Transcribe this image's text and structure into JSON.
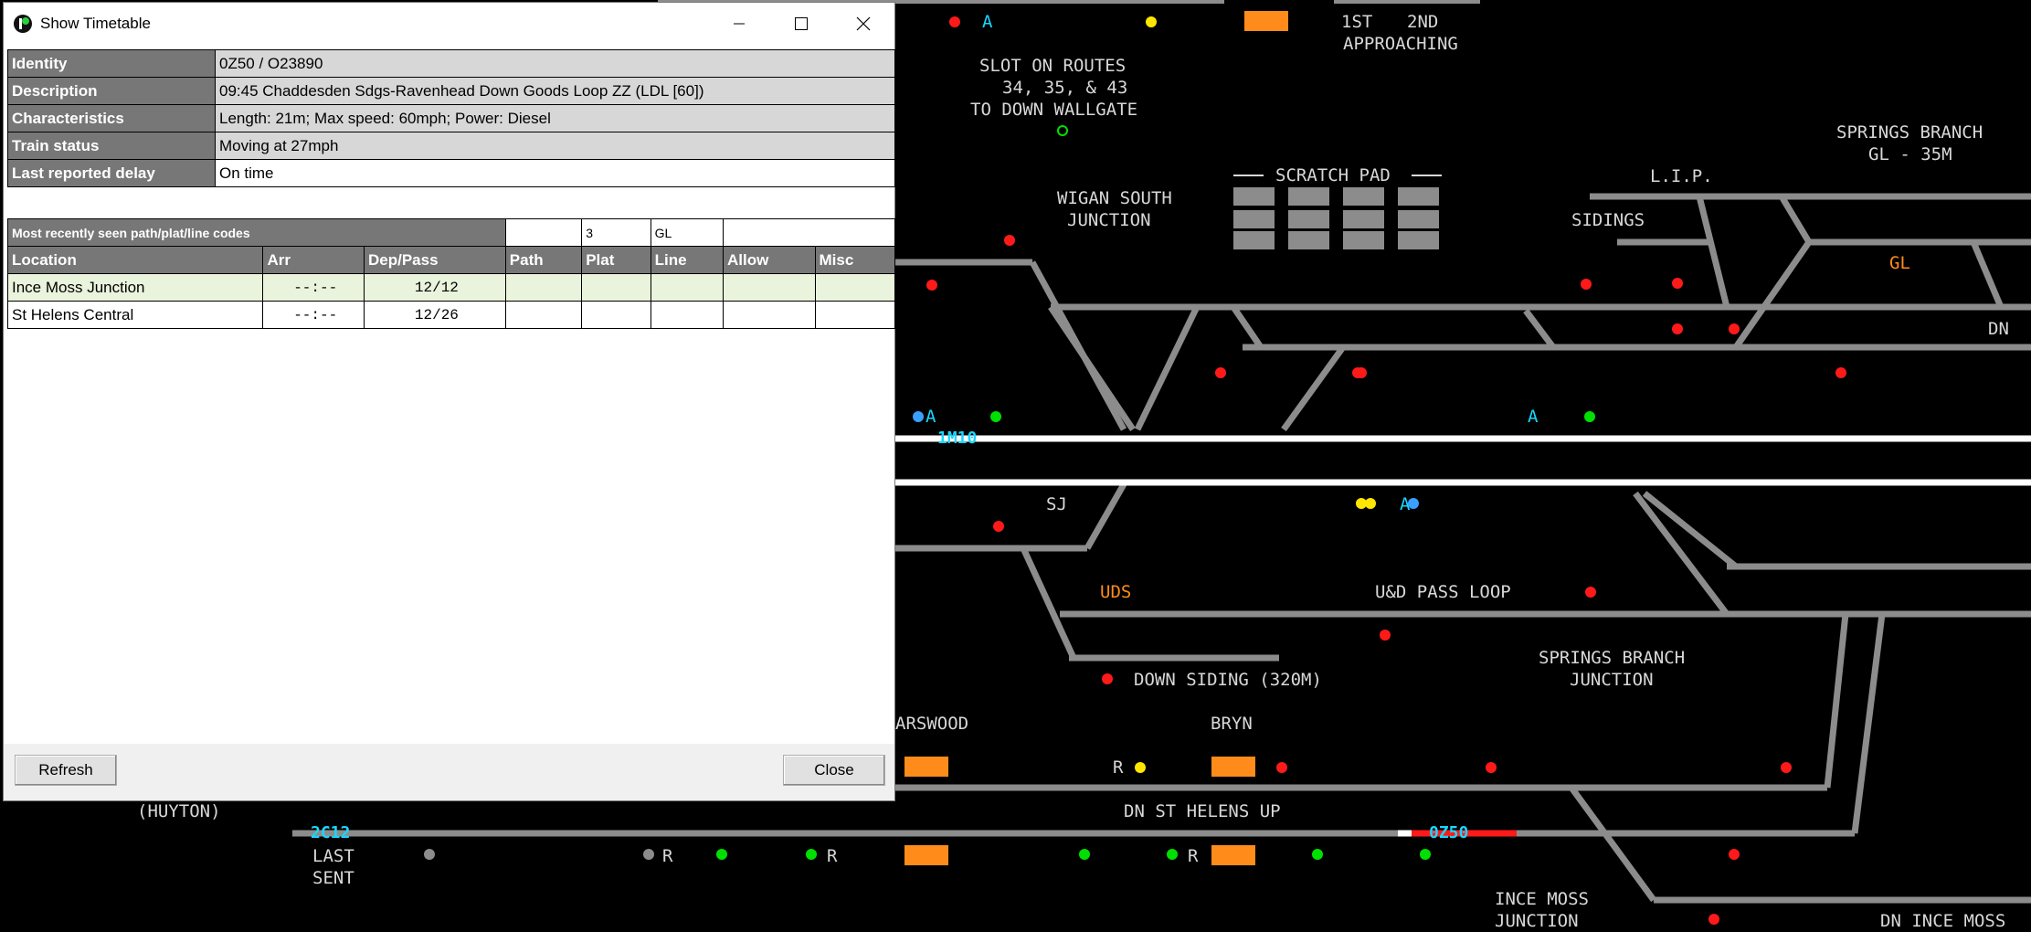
{
  "window": {
    "title": "Show Timetable"
  },
  "train_info": {
    "rows": [
      {
        "key": "Identity",
        "value": "0Z50 / O23890"
      },
      {
        "key": "Description",
        "value": "09:45 Chaddesden Sdgs-Ravenhead Down Goods Loop ZZ (LDL [60])"
      },
      {
        "key": "Characteristics",
        "value": "Length: 21m; Max speed: 60mph; Power: Diesel"
      },
      {
        "key": "Train status",
        "value": "Moving at 27mph"
      },
      {
        "key": "Last reported delay",
        "value": "On time"
      }
    ]
  },
  "path_codes": {
    "caption": "Most recently seen path/plat/line codes",
    "path": "",
    "plat": "3",
    "line": "GL",
    "misc": ""
  },
  "timetable": {
    "headers": [
      "Location",
      "Arr",
      "Dep/Pass",
      "Path",
      "Plat",
      "Line",
      "Allow",
      "Misc"
    ],
    "rows": [
      {
        "location": "Ince Moss Junction",
        "arr": "--:--",
        "dep": "12/12"
      },
      {
        "location": "St Helens Central",
        "arr": "--:--",
        "dep": "12/26"
      }
    ]
  },
  "buttons": {
    "refresh": "Refresh",
    "close": "Close"
  },
  "schematic": {
    "labels": {
      "first": "1ST",
      "second": "2ND",
      "approaching": "APPROACHING",
      "slot1": "SLOT ON ROUTES",
      "slot2": "34, 35, & 43",
      "slot3": "TO DOWN WALLGATE",
      "springs_branch1": "SPRINGS BRANCH",
      "springs_branch2": "GL - 35M",
      "scratch_pad": "SCRATCH PAD",
      "lip": "L.I.P.",
      "sidings": "SIDINGS",
      "wigan1": "WIGAN SOUTH",
      "wigan2": "JUNCTION",
      "gl": "GL",
      "dn_right": "DN",
      "sj": "SJ",
      "uds": "UDS",
      "ud_pass_loop": "U&D PASS LOOP",
      "down_siding": "DOWN SIDING (320M)",
      "sbj1": "SPRINGS BRANCH",
      "sbj2": "JUNCTION",
      "bamfurlong": "ARSWOOD",
      "bryn": "BRYN",
      "huyton": "(HUYTON)",
      "dn_st_helens_up": "DN ST HELENS UP",
      "last": "LAST",
      "sent": "SENT",
      "ince1": "INCE MOSS",
      "ince2": "JUNCTION",
      "dn_ince_moss": "DN INCE MOSS",
      "r1": "R",
      "r2": "R",
      "r3": "R",
      "r4": "R",
      "a1": "A",
      "a2": "A",
      "a3": "A",
      "a4": "A"
    },
    "headcodes": {
      "h1": "1M10",
      "h2": "2C12",
      "h3": "0Z50"
    },
    "colors": {
      "track": "#8c8c8c",
      "route": "#ffffff",
      "occupied": "#ff1a1a",
      "signal_red": "#ff1a1a",
      "signal_green": "#00e000",
      "signal_yellow": "#ffe600",
      "headcode": "#19d6ff",
      "ars": "#ff8c1a"
    }
  }
}
